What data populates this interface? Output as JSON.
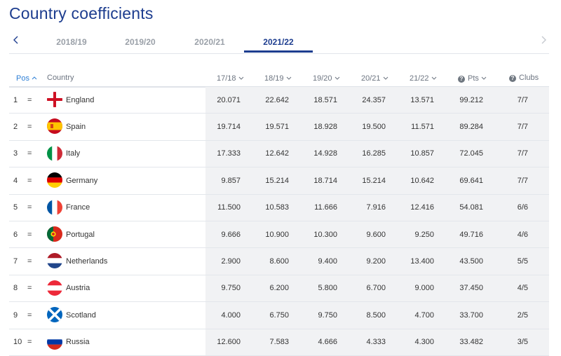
{
  "page": {
    "title": "Country coefficients"
  },
  "tabs": [
    {
      "label": "2018/19"
    },
    {
      "label": "2019/20"
    },
    {
      "label": "2020/21"
    },
    {
      "label": "2021/22",
      "active": true
    }
  ],
  "columns": {
    "pos": "Pos",
    "country": "Country",
    "y1": "17/18",
    "y2": "18/19",
    "y3": "19/20",
    "y4": "20/21",
    "y5": "21/22",
    "pts": "Pts",
    "clubs": "Clubs"
  },
  "colors": {
    "accent": "#1d3d8f",
    "link": "#2e7fd6",
    "shade": "#f1f2f4"
  },
  "rows": [
    {
      "pos": "1",
      "eq": "=",
      "flag": "england-flag",
      "country": "England",
      "y1": "20.071",
      "y2": "22.642",
      "y3": "18.571",
      "y4": "24.357",
      "y5": "13.571",
      "pts": "99.212",
      "clubs": "7/7"
    },
    {
      "pos": "2",
      "eq": "=",
      "flag": "spain-flag",
      "country": "Spain",
      "y1": "19.714",
      "y2": "19.571",
      "y3": "18.928",
      "y4": "19.500",
      "y5": "11.571",
      "pts": "89.284",
      "clubs": "7/7"
    },
    {
      "pos": "3",
      "eq": "=",
      "flag": "italy-flag",
      "country": "Italy",
      "y1": "17.333",
      "y2": "12.642",
      "y3": "14.928",
      "y4": "16.285",
      "y5": "10.857",
      "pts": "72.045",
      "clubs": "7/7"
    },
    {
      "pos": "4",
      "eq": "=",
      "flag": "germany-flag",
      "country": "Germany",
      "y1": "9.857",
      "y2": "15.214",
      "y3": "18.714",
      "y4": "15.214",
      "y5": "10.642",
      "pts": "69.641",
      "clubs": "7/7"
    },
    {
      "pos": "5",
      "eq": "=",
      "flag": "france-flag",
      "country": "France",
      "y1": "11.500",
      "y2": "10.583",
      "y3": "11.666",
      "y4": "7.916",
      "y5": "12.416",
      "pts": "54.081",
      "clubs": "6/6"
    },
    {
      "pos": "6",
      "eq": "=",
      "flag": "portugal-flag",
      "country": "Portugal",
      "y1": "9.666",
      "y2": "10.900",
      "y3": "10.300",
      "y4": "9.600",
      "y5": "9.250",
      "pts": "49.716",
      "clubs": "4/6"
    },
    {
      "pos": "7",
      "eq": "=",
      "flag": "netherlands-flag",
      "country": "Netherlands",
      "y1": "2.900",
      "y2": "8.600",
      "y3": "9.400",
      "y4": "9.200",
      "y5": "13.400",
      "pts": "43.500",
      "clubs": "5/5"
    },
    {
      "pos": "8",
      "eq": "=",
      "flag": "austria-flag",
      "country": "Austria",
      "y1": "9.750",
      "y2": "6.200",
      "y3": "5.800",
      "y4": "6.700",
      "y5": "9.000",
      "pts": "37.450",
      "clubs": "4/5"
    },
    {
      "pos": "9",
      "eq": "=",
      "flag": "scotland-flag",
      "country": "Scotland",
      "y1": "4.000",
      "y2": "6.750",
      "y3": "9.750",
      "y4": "8.500",
      "y5": "4.700",
      "pts": "33.700",
      "clubs": "2/5"
    },
    {
      "pos": "10",
      "eq": "=",
      "flag": "russia-flag",
      "country": "Russia",
      "y1": "12.600",
      "y2": "7.583",
      "y3": "4.666",
      "y4": "4.333",
      "y5": "4.300",
      "pts": "33.482",
      "clubs": "3/5"
    }
  ]
}
